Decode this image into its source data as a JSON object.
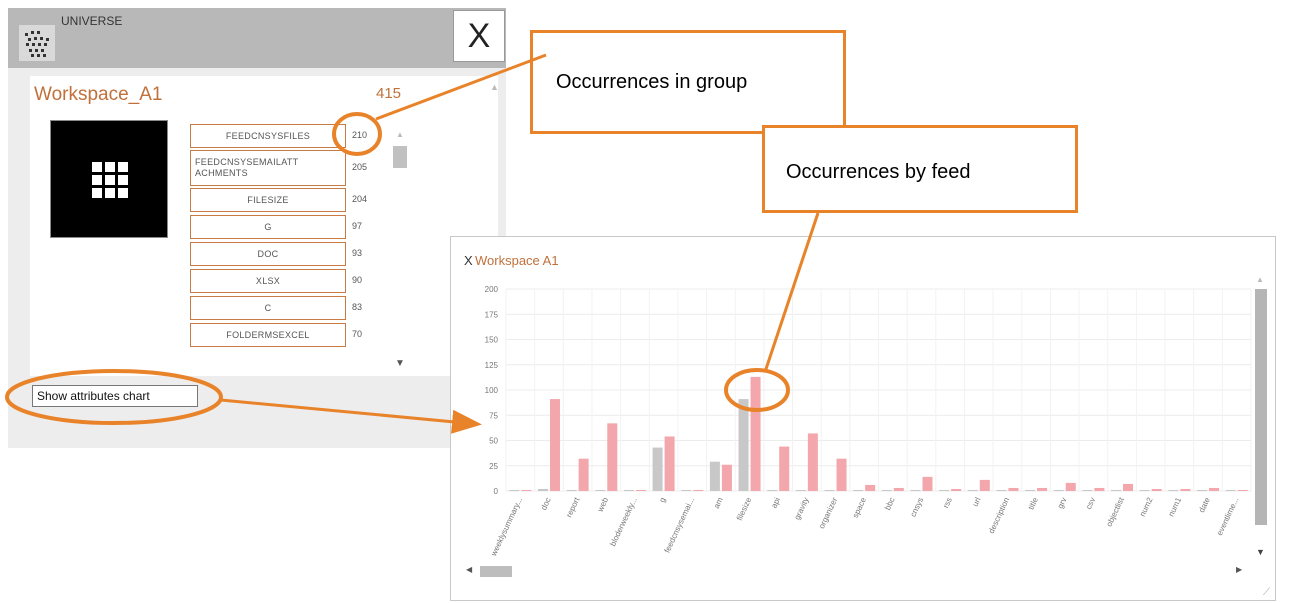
{
  "left_panel": {
    "universe_label": "UNIVERSE",
    "close_label": "X",
    "workspace_title": "Workspace_A1",
    "workspace_count": "415",
    "show_chart_button": "Show attributes chart",
    "attributes": [
      {
        "name": "FEEDCNSYSFILES",
        "count": "210"
      },
      {
        "name": "FEEDCNSYSEMAILATT ACHMENTS",
        "count": "205"
      },
      {
        "name": "FILESIZE",
        "count": "204"
      },
      {
        "name": "G",
        "count": "97"
      },
      {
        "name": "DOC",
        "count": "93"
      },
      {
        "name": "XLSX",
        "count": "90"
      },
      {
        "name": "C",
        "count": "83"
      },
      {
        "name": "FOLDERMSEXCEL",
        "count": "70"
      }
    ]
  },
  "chart_panel": {
    "close_label": "X",
    "title": "Workspace A1"
  },
  "callouts": {
    "group": "Occurrences in group",
    "feed": "Occurrences by feed"
  },
  "colors": {
    "accent_orange": "#e8832a",
    "title_brown": "#c0703a",
    "bar_gray": "#c8c8c8",
    "bar_pink": "#f3a6ab"
  },
  "icons": [
    "universe-icon",
    "grid-icon",
    "close-icon",
    "scroll-arrow-icon",
    "resize-grip-icon"
  ],
  "chart_data": {
    "type": "bar",
    "ylim": [
      0,
      200
    ],
    "y_ticks": [
      0,
      25,
      50,
      75,
      100,
      125,
      150,
      175,
      200
    ],
    "grid": true,
    "categories": [
      "weeklysummary...",
      "doc",
      "report",
      "web",
      "bloderweekly...",
      "g",
      "feedcnsysemai...",
      "am",
      "filesize",
      "api",
      "gravity",
      "organizer",
      "space",
      "bbc",
      "cnsys",
      "rss",
      "url",
      "description",
      "title",
      "grv",
      "csv",
      "objectlist",
      "num2",
      "num1",
      "date",
      "eventlime..."
    ],
    "series": [
      {
        "values": [
          1,
          2,
          1,
          1,
          1,
          43,
          1,
          29,
          91,
          1,
          1,
          1,
          1,
          1,
          1,
          1,
          1,
          1,
          1,
          1,
          1,
          1,
          1,
          1,
          1,
          1
        ]
      },
      {
        "values": [
          1,
          91,
          32,
          67,
          1,
          54,
          1,
          26,
          113,
          44,
          57,
          32,
          6,
          3,
          14,
          2,
          11,
          3,
          3,
          8,
          3,
          7,
          2,
          2,
          3,
          1
        ]
      }
    ]
  }
}
